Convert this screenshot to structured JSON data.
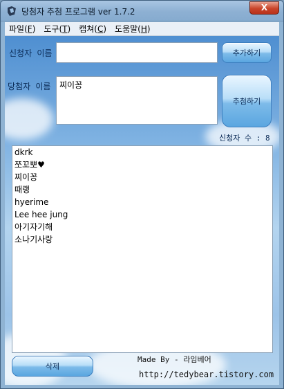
{
  "window": {
    "title": "당첨자 추첨 프로그램 ver 1.7.2",
    "close_label": "X"
  },
  "menu": {
    "items": [
      {
        "label": "파일",
        "accel": "F"
      },
      {
        "label": "도구",
        "accel": "T"
      },
      {
        "label": "캡쳐",
        "accel": "C"
      },
      {
        "label": "도움말",
        "accel": "H"
      }
    ]
  },
  "form": {
    "applicant_label": "신청자 이름",
    "applicant_value": "",
    "add_button": "추가하기",
    "winner_label": "당첨자 이름",
    "winner_value": "찌이꽁",
    "draw_button": "추첨하기",
    "count_label": "신청자 수 : 8"
  },
  "list": {
    "entries": [
      "dkrk",
      "쪼꼬뽀♥",
      "찌이꽁",
      "때랭",
      "hyerime",
      "Lee hee jung",
      "아기자기해",
      "소나기사랑"
    ]
  },
  "footer": {
    "delete_button": "삭제",
    "credit_made_by": "Made By - 라임베어",
    "credit_url": "http://tedybear.tistory.com"
  },
  "colors": {
    "accent_blue": "#5aa6e0",
    "close_red": "#c9442a",
    "label_text": "#0a2a55"
  }
}
